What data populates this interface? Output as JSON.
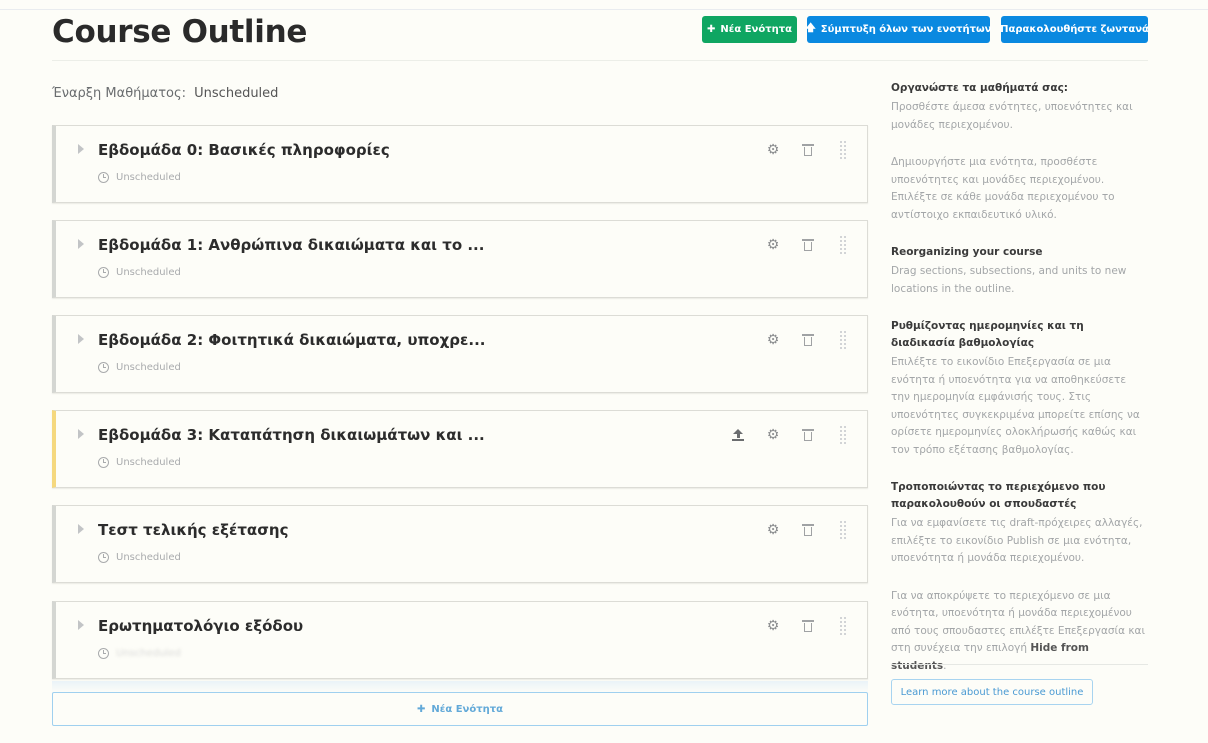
{
  "header": {
    "title": "Course Outline",
    "new_section_label": "Νέα Ενότητα",
    "collapse_all_label": "Σύμπτυξη όλων των ενοτήτων",
    "view_live_label": "Παρακολουθήστε ζωντανά"
  },
  "start_date": {
    "label": "Έναρξη Μαθήματος:",
    "value": "Unscheduled"
  },
  "sections": [
    {
      "title": "Εβδομάδα 0: Βασικές πληροφορίες",
      "status": "Unscheduled"
    },
    {
      "title": "Εβδομάδα 1: Ανθρώπινα δικαιώματα και το ...",
      "status": "Unscheduled"
    },
    {
      "title": "Εβδομάδα 2: Φοιτητικά δικαιώματα, υποχρε...",
      "status": "Unscheduled"
    },
    {
      "title": "Εβδομάδα 3: Καταπάτηση δικαιωμάτων και ...",
      "status": "Unscheduled"
    },
    {
      "title": "Τεστ τελικής εξέτασης",
      "status": "Unscheduled"
    },
    {
      "title": "Ερωτηματολόγιο εξόδου",
      "status": "Unscheduled"
    }
  ],
  "bottom_new_section_label": "Νέα Ενότητα",
  "sidebar": {
    "organize_title": "Οργανώστε τα μαθήματά σας:",
    "organize_text1": "Προσθέστε άμεσα ενότητες, υποενότητες και μονάδες περιεχομένου.",
    "organize_text2": "Δημιουργήστε μια ενότητα, προσθέστε υποενότητες και μονάδες περιεχομένου. Επιλέξτε σε κάθε μονάδα περιεχομένου το αντίστοιχο εκπαιδευτικό υλικό.",
    "reorganize_title": "Reorganizing your course",
    "reorganize_text": "Drag sections, subsections, and units to new locations in the outline.",
    "dates_title": "Ρυθμίζοντας ημερομηνίες και τη διαδικασία βαθμολογίας",
    "dates_text": "Επιλέξτε το εικονίδιο Επεξεργασία σε μια ενότητα ή υποενότητα για να αποθηκεύσετε την ημερομηνία εμφάνισής τους. Στις υποενότητες συγκεκριμένα μπορείτε επίσης να ορίσετε ημερομηνίες ολοκλήρωσής καθώς και τον τρόπο εξέτασης βαθμολογίας.",
    "changing_title": "Τροποποιώντας το περιεχόμενο που παρακολουθούν οι σπουδαστές",
    "changing_text1": "Για να εμφανίσετε τις draft-πρόχειρες αλλαγές, επιλέξτε το εικονίδιο Publish σε μια ενότητα, υποενότητα ή μονάδα περιεχομένου.",
    "changing_text2_pre": "Για να αποκρύψετε το περιεχόμενο σε μια ενότητα, υποενότητα ή μονάδα περιεχομένου από τους σπουδαστες επιλέξτε Επεξεργασία και στη συνέχεια την επιλογή",
    "changing_text2_bold": "Hide from students",
    "changing_text2_post": ".",
    "learn_more_label": "Learn more about the course outline"
  },
  "colors": {
    "green": "#0fa662",
    "blue": "#0a89e0",
    "pending": "#f5d87e"
  }
}
